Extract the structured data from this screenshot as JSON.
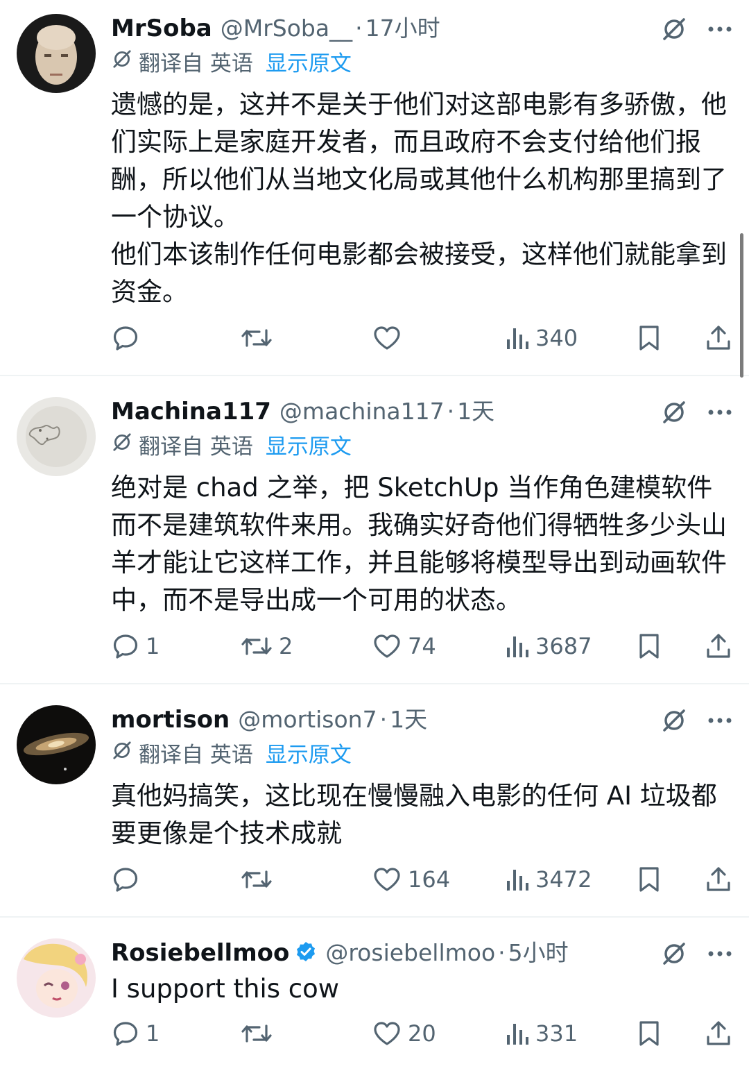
{
  "tweets": [
    {
      "name": "MrSoba",
      "handle": "@MrSoba__",
      "time": "17小时",
      "verified": false,
      "translated_label": "翻译自 英语",
      "show_original": "显示原文",
      "body": [
        "遗憾的是，这并不是关于他们对这部电影有多骄傲，他们实际上是家庭开发者，而且政府不会支付给他们报酬，所以他们从当地文化局或其他什么机构那里搞到了一个协议。",
        "他们本该制作任何电影都会被接受，这样他们就能拿到资金。"
      ],
      "replies": "",
      "retweets": "",
      "likes": "",
      "views": "340"
    },
    {
      "name": "Machina117",
      "handle": "@machina117",
      "time": "1天",
      "verified": false,
      "translated_label": "翻译自 英语",
      "show_original": "显示原文",
      "body": [
        "绝对是 chad 之举，把 SketchUp 当作角色建模软件而不是建筑软件来用。我确实好奇他们得牺牲多少头山羊才能让它这样工作，并且能够将模型导出到动画软件中，而不是导出成一个可用的状态。"
      ],
      "replies": "1",
      "retweets": "2",
      "likes": "74",
      "views": "3687"
    },
    {
      "name": "mortison",
      "handle": "@mortison7",
      "time": "1天",
      "verified": false,
      "translated_label": "翻译自 英语",
      "show_original": "显示原文",
      "body": [
        "真他妈搞笑，这比现在慢慢融入电影的任何 AI 垃圾都要更像是个技术成就"
      ],
      "replies": "",
      "retweets": "",
      "likes": "164",
      "views": "3472"
    },
    {
      "name": "Rosiebellmoo",
      "handle": "@rosiebellmoo",
      "time": "5小时",
      "verified": true,
      "translated_label": "",
      "show_original": "",
      "body": [
        "I support this cow"
      ],
      "replies": "1",
      "retweets": "",
      "likes": "20",
      "views": "331"
    }
  ],
  "separator": "·",
  "colors": {
    "text": "#0f1419",
    "secondary": "#536471",
    "link": "#1d9bf0",
    "divider": "#eff3f4",
    "verified": "#1d9bf0"
  },
  "icons": [
    "grok-icon",
    "more-icon",
    "translate-icon",
    "reply-icon",
    "retweet-icon",
    "like-icon",
    "views-icon",
    "bookmark-icon",
    "share-icon",
    "verified-badge-icon"
  ]
}
